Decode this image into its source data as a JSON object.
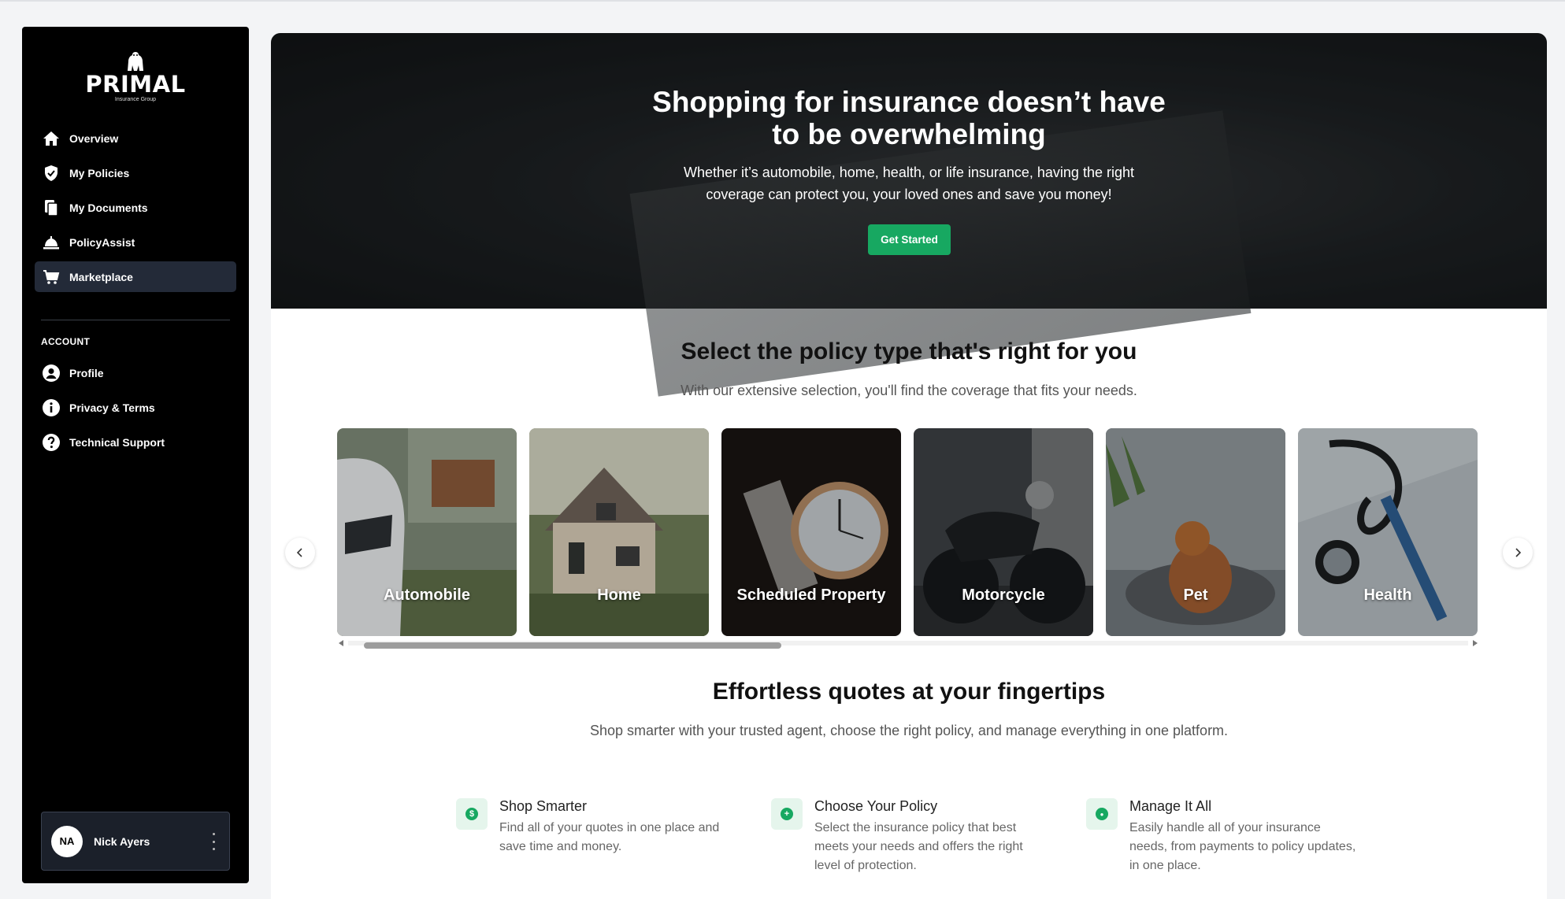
{
  "brand": {
    "name": "PRIMAL",
    "tagline": "Insurance Group"
  },
  "sidebar": {
    "nav": [
      {
        "label": "Overview",
        "icon": "home-icon"
      },
      {
        "label": "My Policies",
        "icon": "shield-icon"
      },
      {
        "label": "My Documents",
        "icon": "documents-icon"
      },
      {
        "label": "PolicyAssist",
        "icon": "service-bell-icon"
      },
      {
        "label": "Marketplace",
        "icon": "cart-icon",
        "active": true
      }
    ],
    "account_title": "ACCOUNT",
    "account": [
      {
        "label": "Profile",
        "icon": "user-circle-icon"
      },
      {
        "label": "Privacy & Terms",
        "icon": "info-icon"
      },
      {
        "label": "Technical Support",
        "icon": "help-icon"
      }
    ],
    "user": {
      "initials": "NA",
      "name": "Nick Ayers"
    }
  },
  "hero": {
    "title_line1": "Shopping for insurance doesn’t have",
    "title_line2": "to be overwhelming",
    "subtitle_line1": "Whether it’s automobile, home, health, or life insurance, having the right",
    "subtitle_line2": "coverage can protect you, your loved ones and save you money!",
    "cta_label": "Get Started"
  },
  "policies": {
    "title": "Select the policy type that's right for you",
    "subtitle": "With our extensive selection, you'll find the coverage that fits your needs.",
    "cards": [
      {
        "label": "Automobile"
      },
      {
        "label": "Home"
      },
      {
        "label": "Scheduled Property"
      },
      {
        "label": "Motorcycle"
      },
      {
        "label": "Pet"
      },
      {
        "label": "Health"
      }
    ]
  },
  "quotes": {
    "title": "Effortless quotes at your fingertips",
    "subtitle": "Shop smarter with your trusted agent, choose the right policy, and manage everything in one platform.",
    "features": [
      {
        "title": "Shop Smarter",
        "description": "Find all of your quotes in one place and save time and money.",
        "icon": "dollar-icon",
        "glyph": "$"
      },
      {
        "title": "Choose Your Policy",
        "description": "Select the insurance policy that best meets your needs and offers the right level of protection.",
        "icon": "plus-icon",
        "glyph": "+"
      },
      {
        "title": "Manage It All",
        "description": "Easily handle all of your insurance needs, from payments to policy updates, in one place.",
        "icon": "user-icon",
        "glyph": "●"
      }
    ]
  },
  "colors": {
    "accent": "#17a861",
    "sidebar_bg": "#000000",
    "active_item": "#232a38"
  }
}
